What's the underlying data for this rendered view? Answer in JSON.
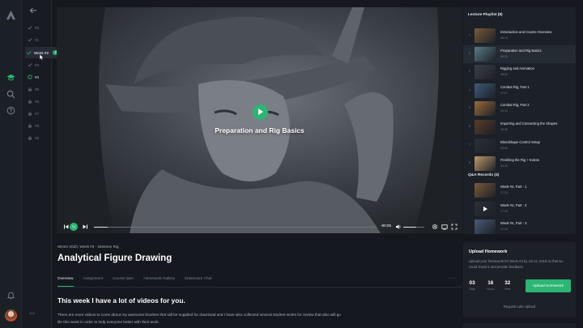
{
  "weeks_nav": {
    "items": [
      {
        "label": "#5",
        "state": "done"
      },
      {
        "label": "#1",
        "state": "done"
      },
      {
        "label": "Week #2",
        "state": "active",
        "badge": "Review"
      },
      {
        "label": "#3",
        "state": "done"
      },
      {
        "label": "#4",
        "state": "current"
      },
      {
        "label": "#5",
        "state": "locked"
      },
      {
        "label": "#6",
        "state": "locked"
      },
      {
        "label": "#7",
        "state": "locked"
      },
      {
        "label": "#8",
        "state": "locked"
      },
      {
        "label": "#9",
        "state": "locked"
      }
    ],
    "collapse_label": ">>"
  },
  "video": {
    "title": "Preparation and Rig Basics",
    "time": "-90:05",
    "speed_label": "1x",
    "progress": 0.05,
    "volume": 0.6
  },
  "lesson": {
    "breadcrumb": "Winter 2020, Week #3 · Skeleton Rig",
    "title": "Analytical Figure Drawing",
    "tabs": [
      {
        "label": "Overview",
        "active": true
      },
      {
        "label": "Assignment",
        "active": false
      },
      {
        "label": "Course Q&A",
        "active": false
      },
      {
        "label": "Homework Gallery",
        "active": false
      },
      {
        "label": "Classroom Chat",
        "active": false
      }
    ],
    "more_label": "···",
    "section_heading": "This week I have a lot of videos for you.",
    "paragraph": "There are more videos to come about my awesome brushes that will be supplied for download and I have also collected several student works for review that also will go life this week in order to help everyone better with their work."
  },
  "playlist": {
    "heading": "Lecture Playlist (8)",
    "items": [
      {
        "num": "1",
        "title": "Introduction and Course Overview",
        "duration": "48:15",
        "active": false,
        "thumb": "#7a5a3a"
      },
      {
        "num": "2",
        "title": "Preparation and Rig Basics",
        "duration": "56:25",
        "active": true,
        "thumb": "#5a7a86"
      },
      {
        "num": "3",
        "title": "Rigging and Animation",
        "duration": "28:52",
        "active": false,
        "thumb": "#3a3f48"
      },
      {
        "num": "4",
        "title": "Combat Rig, Part 1",
        "duration": "17:07",
        "active": false,
        "thumb": "#3d5a7a"
      },
      {
        "num": "5",
        "title": "Combat Rig, Part 2",
        "duration": "20:13",
        "active": false,
        "thumb": "#9a6a3a"
      },
      {
        "num": "6",
        "title": "Importing and Connecting the Shapes",
        "duration": "49:26",
        "active": false,
        "thumb": "#5a3a2a"
      },
      {
        "num": "7",
        "title": "Blendshape Control Setup",
        "duration": "20:42",
        "active": false,
        "thumb": "#2a3038"
      },
      {
        "num": "8",
        "title": "Finishing the Rig + Extras",
        "duration": "55:28",
        "active": false,
        "thumb": "#c09a6a"
      }
    ],
    "qa_heading": "Q&A Records (4)",
    "qa_items": [
      {
        "title": "Week #4, Part - 1",
        "duration": "17:15",
        "thumb": "#7a5a3a"
      },
      {
        "title": "Week #4, Part - 2",
        "duration": "17:15",
        "thumb": "#2a3038"
      },
      {
        "title": "Week #4, Part - 3",
        "duration": "17:15",
        "thumb": "#4a5a7a"
      }
    ]
  },
  "homework": {
    "heading": "Upload Homework",
    "text": "Upload your homework for Week #3 by Jul 12, 2018 so that we could check it and provide feedback.",
    "countdown": [
      {
        "value": "03",
        "unit": "Days"
      },
      {
        "value": "16",
        "unit": "Hours"
      },
      {
        "value": "32",
        "unit": "Mins"
      }
    ],
    "button_label": "Upload Homework",
    "late_label": "Request Late Upload"
  },
  "colors": {
    "accent": "#2bb673",
    "background": "#15191f",
    "panel": "#1c2128"
  }
}
